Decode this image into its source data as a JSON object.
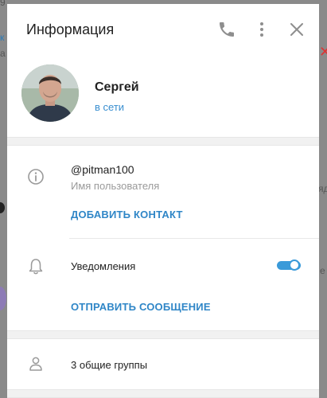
{
  "background": {
    "frag_top_left": "9",
    "frag_left_1": "к",
    "frag_left_2": "а",
    "frag_right_1": "яд",
    "frag_right_2": "е"
  },
  "dialog": {
    "title": "Информация",
    "icons": {
      "call": "phone-icon",
      "menu": "more-vertical-icon",
      "close": "close-icon"
    }
  },
  "profile": {
    "name": "Сергей",
    "status": "в сети"
  },
  "info": {
    "username": "@pitman100",
    "username_caption": "Имя пользователя",
    "add_contact": "ДОБАВИТЬ КОНТАКТ"
  },
  "notifications": {
    "label": "Уведомления",
    "enabled": true,
    "send_message": "ОТПРАВИТЬ СООБЩЕНИЕ"
  },
  "groups": {
    "label": "3 общие группы"
  },
  "colors": {
    "accent": "#2f86c7",
    "toggle": "#3a9ad9",
    "status": "#3a8fd0"
  }
}
